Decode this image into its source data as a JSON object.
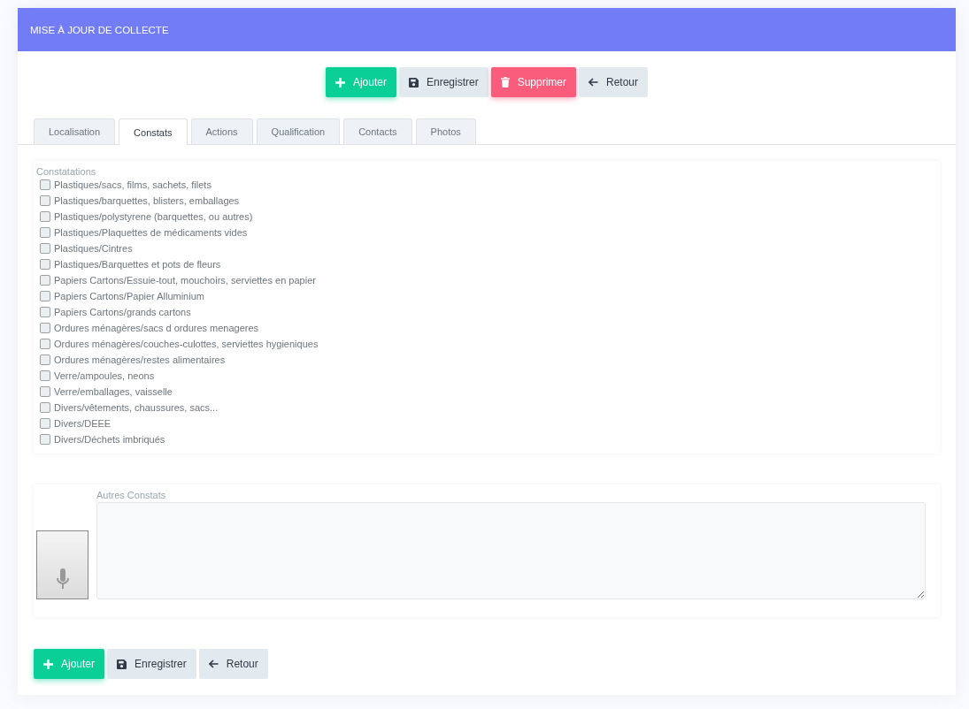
{
  "header": {
    "title": "MISE À JOUR DE COLLECTE"
  },
  "top_buttons": [
    {
      "kind": "add",
      "label": "Ajouter"
    },
    {
      "kind": "save",
      "label": "Enregistrer"
    },
    {
      "kind": "delete",
      "label": "Supprimer"
    },
    {
      "kind": "back",
      "label": "Retour"
    }
  ],
  "tabs": [
    {
      "label": "Localisation",
      "selected": false
    },
    {
      "label": "Constats",
      "selected": true
    },
    {
      "label": "Actions",
      "selected": false
    },
    {
      "label": "Qualification",
      "selected": false
    },
    {
      "label": "Contacts",
      "selected": false
    },
    {
      "label": "Photos",
      "selected": false
    }
  ],
  "constatations": {
    "label": "Constatations",
    "items": [
      {
        "label": "Plastiques/sacs, films, sachets, filets",
        "checked": false
      },
      {
        "label": "Plastiques/barquettes, blisters, emballages",
        "checked": false
      },
      {
        "label": "Plastiques/polystyrene (barquettes, ou autres)",
        "checked": false
      },
      {
        "label": "Plastiques/Plaquettes de médicaments vides",
        "checked": false
      },
      {
        "label": "Plastiques/Cintres",
        "checked": false
      },
      {
        "label": "Plastiques/Barquettes et pots de fleurs",
        "checked": false
      },
      {
        "label": "Papiers Cartons/Essuie-tout, mouchoirs, serviettes en papier",
        "checked": false
      },
      {
        "label": "Papiers Cartons/Papier Alluminium",
        "checked": false
      },
      {
        "label": "Papiers Cartons/grands cartons",
        "checked": false
      },
      {
        "label": "Ordures ménagères/sacs d ordures menageres",
        "checked": false
      },
      {
        "label": "Ordures ménagères/couches-culottes, serviettes hygieniques",
        "checked": false
      },
      {
        "label": "Ordures ménagères/restes alimentaires",
        "checked": false
      },
      {
        "label": "Verre/ampoules, neons",
        "checked": false
      },
      {
        "label": "Verre/emballages, vaisselle",
        "checked": false
      },
      {
        "label": "Divers/vêtements, chaussures, sacs...",
        "checked": false
      },
      {
        "label": "Divers/DEEE",
        "checked": false
      },
      {
        "label": "Divers/Déchets imbriqués",
        "checked": false
      }
    ]
  },
  "autres_constats": {
    "label": "Autres Constats"
  },
  "bottom_buttons": [
    {
      "kind": "add",
      "label": "Ajouter"
    },
    {
      "kind": "save",
      "label": "Enregistrer"
    },
    {
      "kind": "back",
      "label": "Retour"
    }
  ]
}
